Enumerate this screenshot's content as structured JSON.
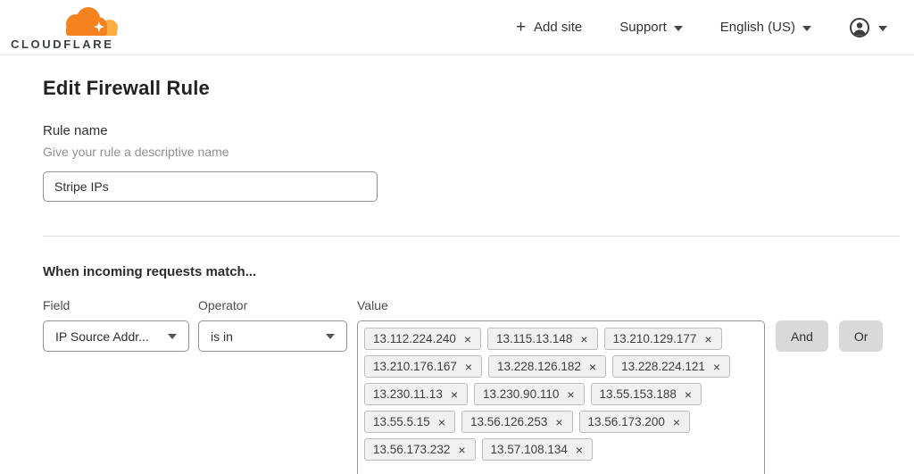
{
  "header": {
    "logo_text": "CLOUDFLARE",
    "nav": {
      "add_site": "Add site",
      "support": "Support",
      "language": "English (US)"
    }
  },
  "icons": {
    "plus": "+",
    "remove": "×"
  },
  "colors": {
    "brand_orange": "#f6821f",
    "brand_orange_light": "#fbad41",
    "button_gray": "#d9d9d9"
  },
  "page": {
    "title": "Edit Firewall Rule",
    "rule_name": {
      "label": "Rule name",
      "helper": "Give your rule a descriptive name",
      "value": "Stripe IPs"
    },
    "match_heading": "When incoming requests match...",
    "builder": {
      "field": {
        "label": "Field",
        "selected": "IP Source Addr..."
      },
      "operator": {
        "label": "Operator",
        "selected": "is in"
      },
      "value": {
        "label": "Value",
        "tags": [
          "13.112.224.240",
          "13.115.13.148",
          "13.210.129.177",
          "13.210.176.167",
          "13.228.126.182",
          "13.228.224.121",
          "13.230.11.13",
          "13.230.90.110",
          "13.55.153.188",
          "13.55.5.15",
          "13.56.126.253",
          "13.56.173.200",
          "13.56.173.232",
          "13.57.108.134"
        ]
      },
      "and_label": "And",
      "or_label": "Or"
    }
  }
}
